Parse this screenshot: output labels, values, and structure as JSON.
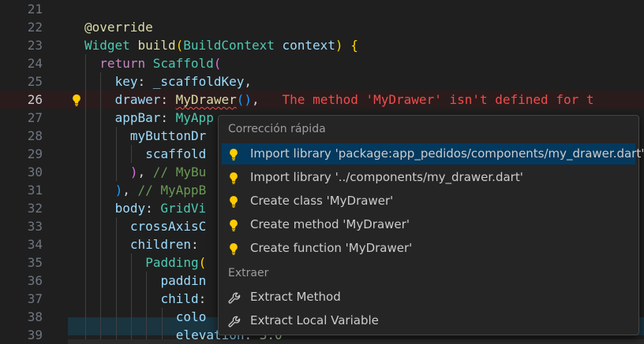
{
  "editor": {
    "lines": [
      {
        "num": "21"
      },
      {
        "num": "22",
        "tokens": [
          {
            "t": "@override",
            "c": "c-ann"
          }
        ]
      },
      {
        "num": "23",
        "tokens": [
          {
            "t": "Widget",
            "c": "c-type"
          },
          {
            "t": " ",
            "c": "c-def"
          },
          {
            "t": "build",
            "c": "c-fn"
          },
          {
            "t": "(",
            "c": "c-br1"
          },
          {
            "t": "BuildContext",
            "c": "c-type"
          },
          {
            "t": " ",
            "c": "c-def"
          },
          {
            "t": "context",
            "c": "c-var"
          },
          {
            "t": ")",
            "c": "c-br1"
          },
          {
            "t": " ",
            "c": "c-def"
          },
          {
            "t": "{",
            "c": "c-br1"
          }
        ]
      },
      {
        "num": "24",
        "indent": 1,
        "tokens": [
          {
            "t": "return",
            "c": "c-kw"
          },
          {
            "t": " ",
            "c": "c-def"
          },
          {
            "t": "Scaffold",
            "c": "c-type"
          },
          {
            "t": "(",
            "c": "c-br2"
          }
        ]
      },
      {
        "num": "25",
        "indent": 2,
        "tokens": [
          {
            "t": "key",
            "c": "c-var"
          },
          {
            "t": ": ",
            "c": "c-def"
          },
          {
            "t": "_scaffoldKey",
            "c": "c-var"
          },
          {
            "t": ",",
            "c": "c-def"
          }
        ]
      },
      {
        "num": "26",
        "indent": 2,
        "active": true,
        "tokens": [
          {
            "t": "drawer",
            "c": "c-var"
          },
          {
            "t": ": ",
            "c": "c-def"
          },
          {
            "t": "MyDrawer",
            "c": "c-fn squiggle"
          },
          {
            "t": "(",
            "c": "c-br3"
          },
          {
            "t": ")",
            "c": "c-br3"
          },
          {
            "t": ",",
            "c": "c-def"
          },
          {
            "t": "   The method 'MyDrawer' isn't defined for t",
            "c": "err"
          }
        ]
      },
      {
        "num": "27",
        "indent": 2,
        "tokens": [
          {
            "t": "appBar",
            "c": "c-var"
          },
          {
            "t": ": ",
            "c": "c-def"
          },
          {
            "t": "MyApp",
            "c": "c-type"
          }
        ]
      },
      {
        "num": "28",
        "indent": 3,
        "tokens": [
          {
            "t": "myButtonDr",
            "c": "c-var"
          }
        ]
      },
      {
        "num": "29",
        "indent": 4,
        "tokens": [
          {
            "t": "scaffold",
            "c": "c-var"
          }
        ]
      },
      {
        "num": "30",
        "indent": 3,
        "tokens": [
          {
            "t": ")",
            "c": "c-br2"
          },
          {
            "t": ", ",
            "c": "c-def"
          },
          {
            "t": "// MyBu",
            "c": "c-cmt"
          }
        ]
      },
      {
        "num": "31",
        "indent": 2,
        "tokens": [
          {
            "t": ")",
            "c": "c-br3"
          },
          {
            "t": ", ",
            "c": "c-def"
          },
          {
            "t": "// MyAppB",
            "c": "c-cmt"
          }
        ]
      },
      {
        "num": "32",
        "indent": 2,
        "tokens": [
          {
            "t": "body",
            "c": "c-var"
          },
          {
            "t": ": ",
            "c": "c-def"
          },
          {
            "t": "GridVi",
            "c": "c-type"
          }
        ]
      },
      {
        "num": "33",
        "indent": 3,
        "tokens": [
          {
            "t": "crossAxisC",
            "c": "c-var"
          }
        ]
      },
      {
        "num": "34",
        "indent": 3,
        "tokens": [
          {
            "t": "children",
            "c": "c-var"
          },
          {
            "t": ": ",
            "c": "c-def"
          }
        ]
      },
      {
        "num": "35",
        "indent": 4,
        "tokens": [
          {
            "t": "Padding",
            "c": "c-type"
          },
          {
            "t": "(",
            "c": "c-br1"
          }
        ]
      },
      {
        "num": "36",
        "indent": 5,
        "tokens": [
          {
            "t": "paddin",
            "c": "c-var"
          }
        ]
      },
      {
        "num": "37",
        "indent": 5,
        "tokens": [
          {
            "t": "child",
            "c": "c-var"
          },
          {
            "t": ":",
            "c": "c-def"
          }
        ]
      },
      {
        "num": "38",
        "indent": 6,
        "tokens": [
          {
            "t": "colo",
            "c": "c-var"
          }
        ]
      },
      {
        "num": "39",
        "indent": 6,
        "tokens": [
          {
            "t": "elevation",
            "c": "c-var"
          },
          {
            "t": ": ",
            "c": "c-def"
          },
          {
            "t": "3.0",
            "c": "c-num"
          }
        ]
      }
    ]
  },
  "quickfix": {
    "header_quick": "Corrección rápida",
    "header_extract": "Extraer",
    "items": [
      {
        "label": "Import library 'package:app_pedidos/components/my_drawer.dart'",
        "icon": "lightbulb-icon",
        "active": true
      },
      {
        "label": "Import library '../components/my_drawer.dart'",
        "icon": "lightbulb-icon"
      },
      {
        "label": "Create class 'MyDrawer'",
        "icon": "lightbulb-icon"
      },
      {
        "label": "Create method 'MyDrawer'",
        "icon": "lightbulb-icon"
      },
      {
        "label": "Create function 'MyDrawer'",
        "icon": "lightbulb-icon"
      }
    ],
    "extract_items": [
      {
        "label": "Extract Method",
        "icon": "wrench-icon"
      },
      {
        "label": "Extract Local Variable",
        "icon": "wrench-icon"
      }
    ]
  },
  "colors": {
    "bulb": "#ffcc00",
    "selected": "#04395e",
    "error": "#f14c4c"
  }
}
